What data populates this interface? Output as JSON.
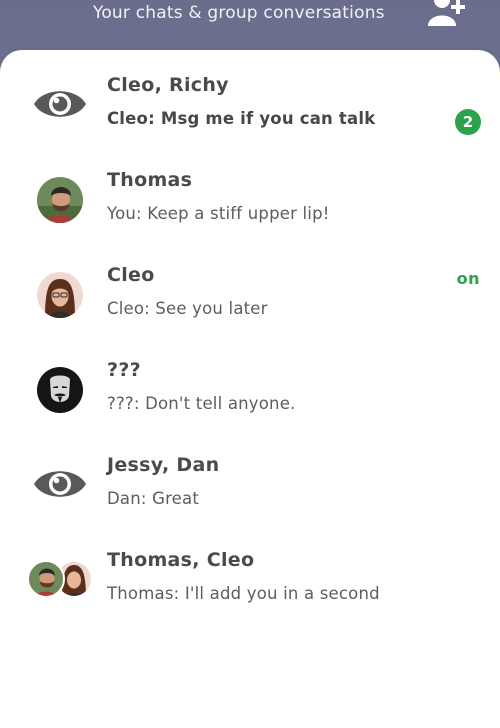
{
  "header": {
    "subtitle": "Your chats & group conversations",
    "add_contact_icon": "add-person-icon"
  },
  "colors": {
    "header_bg": "#6a6d8b",
    "accent_green": "#2ca24a",
    "name_text": "#4a4a4a",
    "preview_text": "#5d5d5d"
  },
  "chats": [
    {
      "name": "Cleo, Richy",
      "preview": "Cleo: Msg me if you can talk",
      "unread_count": "2",
      "avatar": "eye-icon"
    },
    {
      "name": "Thomas",
      "preview": "You: Keep a stiff upper lip!",
      "avatar": "avatar-thomas"
    },
    {
      "name": "Cleo",
      "preview": "Cleo: See you later",
      "status": "on",
      "avatar": "avatar-cleo"
    },
    {
      "name": "???",
      "preview": "???: Don't tell anyone.",
      "avatar": "avatar-anonymous-mask"
    },
    {
      "name": "Jessy, Dan",
      "preview": "Dan: Great",
      "avatar": "eye-icon"
    },
    {
      "name": "Thomas, Cleo",
      "preview": "Thomas: I'll add you in a second",
      "avatar": "avatar-pair-thomas-cleo"
    }
  ]
}
